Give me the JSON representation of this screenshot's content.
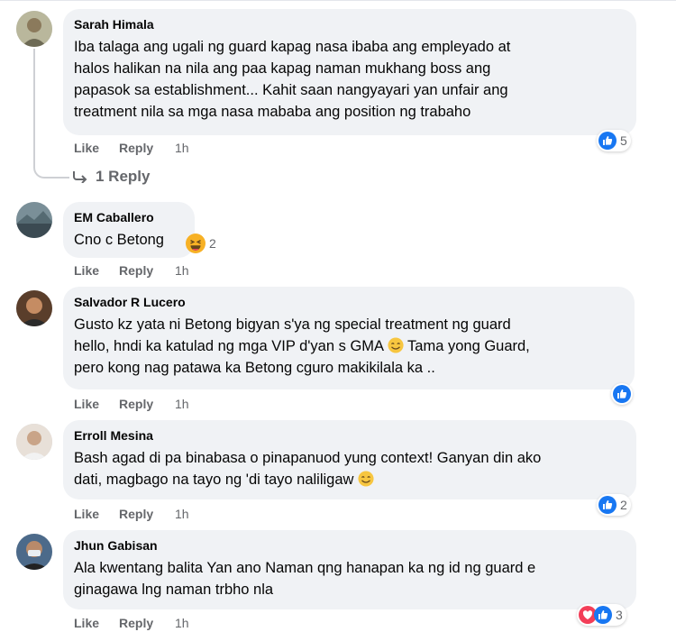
{
  "comments": [
    {
      "author": "Sarah Himala",
      "lines": [
        "Iba talaga ang ugali ng guard kapag nasa ibaba ang empleyado at",
        "halos halikan na nila ang paa kapag naman mukhang boss ang",
        "papasok sa establishment... Kahit saan nangyayari yan unfair ang",
        "treatment nila sa mga nasa mababa ang position ng trabaho"
      ],
      "like": "Like",
      "reply": "Reply",
      "time": "1h",
      "reaction_count": "5",
      "replies_link": "1 Reply"
    },
    {
      "author": "EM Caballero",
      "text": "Cno c Betong",
      "reaction_count": "2",
      "like": "Like",
      "reply": "Reply",
      "time": "1h"
    },
    {
      "author": "Salvador R Lucero",
      "lines": [
        "Gusto kz yata ni Betong bigyan s'ya ng special treatment ng guard",
        "hello, hndi ka katulad ng mga VIP d'yan s GMA",
        "Tama yong Guard,",
        "pero kong nag patawa ka Betong cguro makikilala ka .."
      ],
      "like": "Like",
      "reply": "Reply",
      "time": "1h"
    },
    {
      "author": "Erroll Mesina",
      "lines": [
        "Bash agad di pa binabasa o pinapanuod yung context! Ganyan din ako",
        "dati, magbago na tayo ng 'di tayo naliligaw"
      ],
      "like": "Like",
      "reply": "Reply",
      "time": "1h",
      "reaction_count": "2"
    },
    {
      "author": "Jhun Gabisan",
      "lines": [
        "Ala kwentang balita Yan ano Naman qng hanapan ka ng id ng guard e",
        "ginagawa lng naman trbho nla"
      ],
      "like": "Like",
      "reply": "Reply",
      "time": "1h",
      "reaction_count": "3"
    }
  ],
  "colors": {
    "bubble": "#f0f2f5",
    "like_blue": "#1877f2",
    "love_red": "#f33e58",
    "meta_gray": "#65676b"
  },
  "icons": {
    "like_reaction": "thumbs-up-icon",
    "love_reaction": "heart-icon",
    "haha_reaction": "laughing-emoji",
    "smile_emoji": "smiling-emoji",
    "reply_arrow": "reply-arrow-icon"
  }
}
